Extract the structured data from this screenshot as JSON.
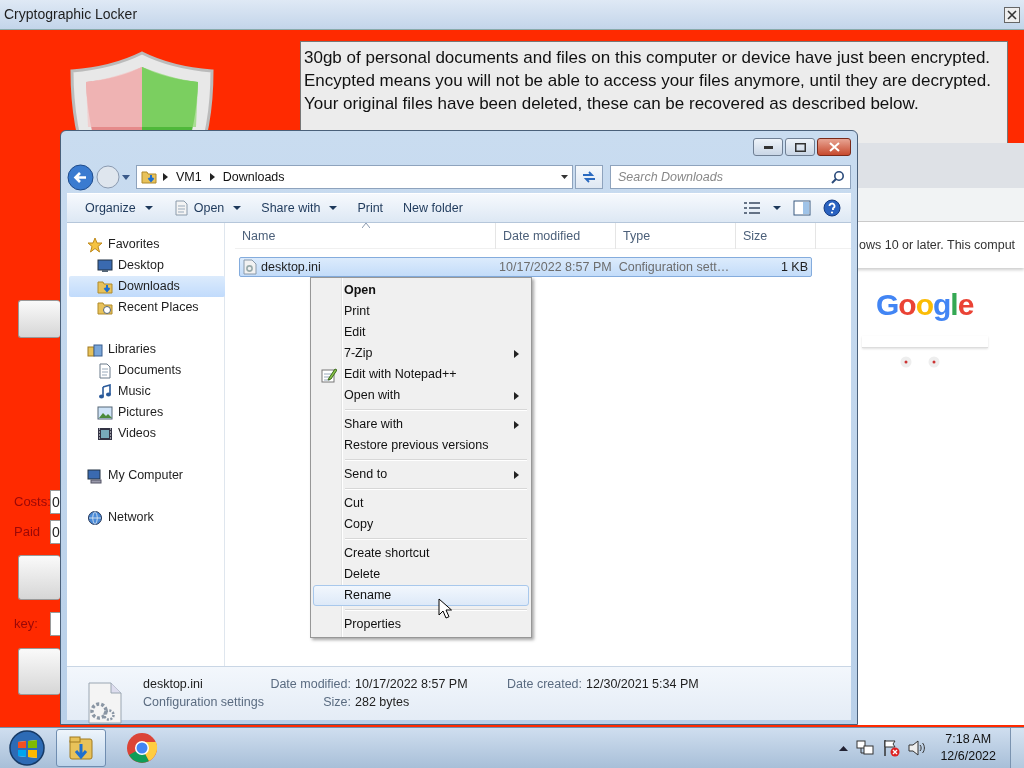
{
  "locker_window": {
    "title": "Cryptographic Locker",
    "message_lines": [
      "30gb of personal documents and files on this computer or device have just been encrypted.",
      "Encypted means you will not be able to access your files anymore, until they are decrypted.",
      "Your original files have been deleted, these can be recovered as described below."
    ],
    "fields": [
      {
        "label": "Costs:",
        "value": "0"
      },
      {
        "label": "Paid",
        "value": "0"
      },
      {
        "label": "key:"
      }
    ]
  },
  "browser_window": {
    "banner_text": "ows 10 or later. This comput",
    "logo_text": "Google"
  },
  "explorer_window": {
    "path": [
      "VM1",
      "Downloads"
    ],
    "search": {
      "placeholder": "Search Downloads"
    },
    "toolbar": [
      {
        "label": "Organize",
        "kind": "plain",
        "dropdown": true
      },
      {
        "label": "Open",
        "kind": "icon",
        "dropdown": true
      },
      {
        "label": "Share with",
        "kind": "plain",
        "dropdown": true
      },
      {
        "label": "Print",
        "kind": "plain",
        "dropdown": false
      },
      {
        "label": "New folder",
        "kind": "plain",
        "dropdown": false
      }
    ],
    "nav": [
      {
        "label": "Favorites",
        "kind": "star",
        "selected": false,
        "children": [
          {
            "label": "Desktop",
            "kind": "desktop",
            "selected": false
          },
          {
            "label": "Downloads",
            "kind": "downloads",
            "selected": true
          },
          {
            "label": "Recent Places",
            "kind": "recent",
            "selected": false
          }
        ]
      },
      {
        "label": "Libraries",
        "kind": "libraries",
        "selected": false,
        "children": [
          {
            "label": "Documents",
            "kind": "documents",
            "selected": false
          },
          {
            "label": "Music",
            "kind": "music",
            "selected": false
          },
          {
            "label": "Pictures",
            "kind": "pictures",
            "selected": false
          },
          {
            "label": "Videos",
            "kind": "videos",
            "selected": false
          }
        ]
      },
      {
        "label": "My Computer",
        "kind": "computer",
        "selected": false
      },
      {
        "label": "Network",
        "kind": "network",
        "selected": false
      }
    ],
    "columns": [
      "Name",
      "Date modified",
      "Type",
      "Size"
    ],
    "rows": [
      {
        "cells": [
          "desktop.ini",
          "10/17/2022 8:57 PM",
          "Configuration sett…",
          "1 KB"
        ],
        "selected": true
      }
    ],
    "details": {
      "name": "desktop.ini",
      "type": "Configuration settings",
      "fields": [
        {
          "label": "Date modified:",
          "value": "10/17/2022 8:57 PM"
        },
        {
          "label": "Size:",
          "value": "282 bytes"
        },
        {
          "label": "Date created:",
          "value": "12/30/2021 5:34 PM"
        }
      ]
    }
  },
  "context_menu": {
    "groups": [
      {
        "items": [
          {
            "label": "Open",
            "kind": "plain",
            "default": true,
            "submenu": false,
            "selected": false
          },
          {
            "label": "Print",
            "kind": "plain",
            "default": false,
            "submenu": false,
            "selected": false
          },
          {
            "label": "Edit",
            "kind": "plain",
            "default": false,
            "submenu": false,
            "selected": false
          },
          {
            "label": "7-Zip",
            "kind": "plain",
            "default": false,
            "submenu": true,
            "selected": false
          },
          {
            "label": "Edit with Notepad++",
            "kind": "icon",
            "default": false,
            "submenu": false,
            "selected": false
          },
          {
            "label": "Open with",
            "kind": "plain",
            "default": false,
            "submenu": true,
            "selected": false
          }
        ]
      },
      {
        "items": [
          {
            "label": "Share with",
            "kind": "plain",
            "default": false,
            "submenu": true,
            "selected": false
          },
          {
            "label": "Restore previous versions",
            "kind": "plain",
            "default": false,
            "submenu": false,
            "selected": false
          }
        ]
      },
      {
        "items": [
          {
            "label": "Send to",
            "kind": "plain",
            "default": false,
            "submenu": true,
            "selected": false
          }
        ]
      },
      {
        "items": [
          {
            "label": "Cut",
            "kind": "plain",
            "default": false,
            "submenu": false,
            "selected": false
          },
          {
            "label": "Copy",
            "kind": "plain",
            "default": false,
            "submenu": false,
            "selected": false
          }
        ]
      },
      {
        "items": [
          {
            "label": "Create shortcut",
            "kind": "plain",
            "default": false,
            "submenu": false,
            "selected": false
          },
          {
            "label": "Delete",
            "kind": "plain",
            "default": false,
            "submenu": false,
            "selected": false
          },
          {
            "label": "Rename",
            "kind": "plain",
            "default": false,
            "submenu": false,
            "selected": true
          }
        ]
      },
      {
        "items": [
          {
            "label": "Properties",
            "kind": "plain",
            "default": false,
            "submenu": false,
            "selected": false
          }
        ]
      }
    ]
  },
  "taskbar": {
    "buttons": [
      {
        "kind": "explorer",
        "selected": true
      },
      {
        "kind": "chrome",
        "selected": false
      }
    ],
    "clock": {
      "time": "7:18 AM",
      "date": "12/6/2022"
    }
  }
}
